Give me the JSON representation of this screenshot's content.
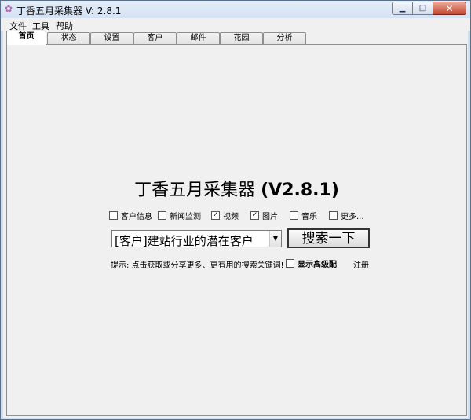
{
  "window": {
    "title": "丁香五月采集器 V: 2.8.1",
    "icon": "app-flower-icon",
    "controls": {
      "minimize": "minimize-icon",
      "maximize": "maximize-icon",
      "close": "close-icon"
    }
  },
  "menu": [
    "文件",
    "工具",
    "帮助"
  ],
  "tabs": [
    {
      "label": "首页",
      "active": true
    },
    {
      "label": "状态",
      "active": false
    },
    {
      "label": "设置",
      "active": false
    },
    {
      "label": "客户",
      "active": false
    },
    {
      "label": "邮件",
      "active": false
    },
    {
      "label": "花园",
      "active": false
    },
    {
      "label": "分析",
      "active": false
    }
  ],
  "main": {
    "heading_name": "丁香五月采集器",
    "heading_version": "(V2.8.1)",
    "options": [
      {
        "label": "客户信息",
        "checked": false
      },
      {
        "label": "新闻监测",
        "checked": false
      },
      {
        "label": "视频",
        "checked": true
      },
      {
        "label": "图片",
        "checked": true
      },
      {
        "label": "音乐",
        "checked": false
      },
      {
        "label": "更多...",
        "checked": false
      }
    ],
    "search_value": "[客户]建站行业的潜在客户",
    "search_button": "搜索一下",
    "hint": "提示: 点击获取或分享更多、更有用的搜索关键词!",
    "advanced_label": "显示高级配",
    "advanced_checked": false,
    "register_label": "注册"
  }
}
